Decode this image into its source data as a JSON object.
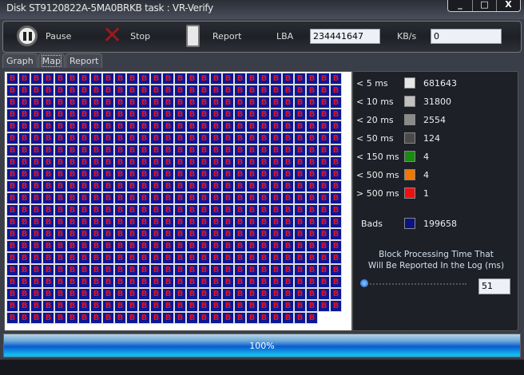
{
  "window": {
    "title": "Disk ST9120822A-5MA0BRKB    task : VR-Verify",
    "minimize": "_",
    "maximize": "□",
    "close": "X"
  },
  "toolbar": {
    "pause": "Pause",
    "stop": "Stop",
    "report": "Report",
    "lba_label": "LBA",
    "lba_value": "234441647",
    "kbs_label": "KB/s",
    "kbs_value": "0"
  },
  "tabs": [
    "Graph",
    "Map",
    "Report"
  ],
  "map": {
    "cell_label": "B",
    "cell_count": 586
  },
  "legend": [
    {
      "label": "< 5 ms",
      "color": "#e6e6e6",
      "count": "681643"
    },
    {
      "label": "< 10 ms",
      "color": "#c0c0c0",
      "count": "31800"
    },
    {
      "label": "< 20 ms",
      "color": "#8a8a8a",
      "count": "2554"
    },
    {
      "label": "< 50 ms",
      "color": "#4a4a4a",
      "count": "124"
    },
    {
      "label": "< 150 ms",
      "color": "#1a8a10",
      "count": "4"
    },
    {
      "label": "< 500 ms",
      "color": "#f07800",
      "count": "4"
    },
    {
      "label": "> 500 ms",
      "color": "#ee1010",
      "count": "1"
    },
    {
      "label": "Bads",
      "color": "#0a1480",
      "count": "199658"
    }
  ],
  "threshold": {
    "caption_line1": "Block Processing Time That",
    "caption_line2": "Will Be Reported In the Log (ms)",
    "value": "51"
  },
  "progress": {
    "text": "100%",
    "percent": 100
  }
}
